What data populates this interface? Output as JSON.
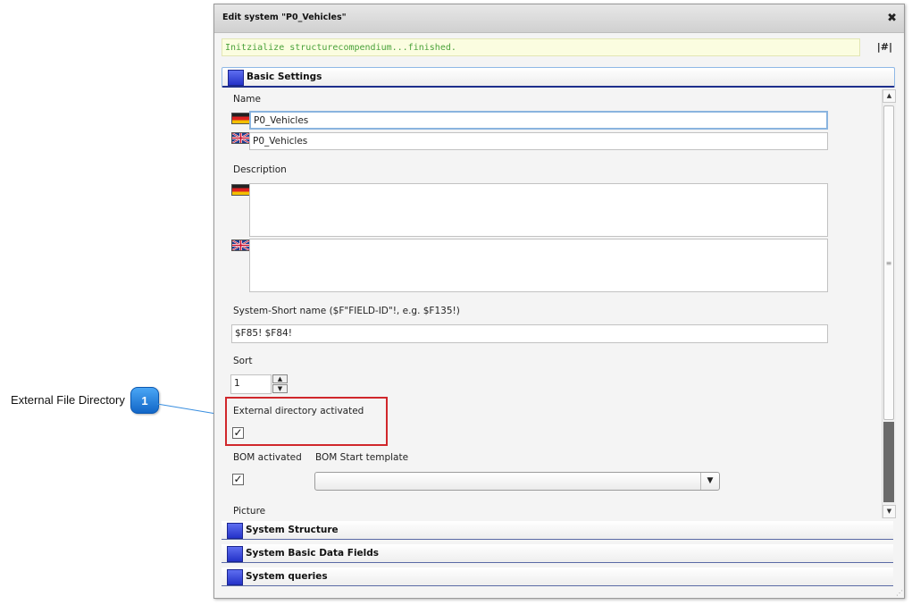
{
  "callout": {
    "label": "External File Directory",
    "number": "1"
  },
  "dialog": {
    "title": "Edit system \"P0_Vehicles\"",
    "close_icon": "close-icon",
    "status_message": "Initzialize structurecompendium...finished.",
    "status_link": "|#|"
  },
  "sections": {
    "basic": "Basic Settings",
    "structure": "System Structure",
    "data_fields": "System Basic Data Fields",
    "queries": "System queries"
  },
  "form": {
    "name_label": "Name",
    "name_de": "P0_Vehicles",
    "name_en": "P0_Vehicles",
    "description_label": "Description",
    "short_name_label": "System-Short name ($F\"FIELD-ID\"!, e.g. $F135!)",
    "short_name_value": "$F85! $F84!",
    "sort_label": "Sort",
    "sort_value": "1",
    "external_dir_label": "External directory activated",
    "external_dir_checked": true,
    "bom_activated_label": "BOM activated",
    "bom_activated_checked": true,
    "bom_template_label": "BOM Start template",
    "bom_template_value": "",
    "picture_label": "Picture",
    "check_mark": "✓"
  },
  "colors": {
    "status_text": "#4aa23a",
    "highlight": "#d0272b",
    "callout": "#1a73d8",
    "section_icon": "#2432c8"
  }
}
